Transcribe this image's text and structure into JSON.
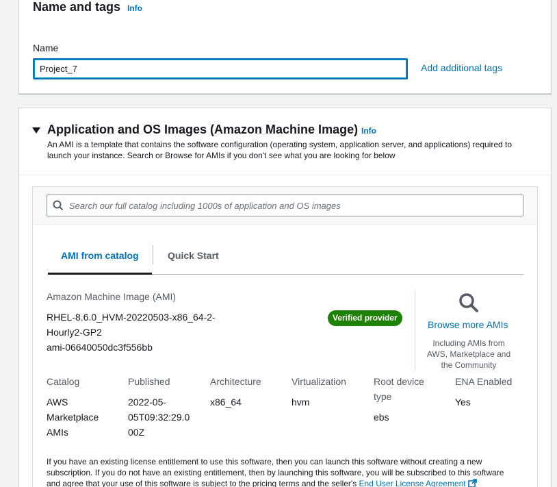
{
  "name_tags": {
    "title": "Name and tags",
    "info": "Info",
    "name_label": "Name",
    "name_value": "Project_7",
    "add_tags": "Add additional tags"
  },
  "ami_section": {
    "title": "Application and OS Images (Amazon Machine Image)",
    "info": "Info",
    "description_line1": "An AMI is a template that contains the software configuration (operating system, application server, and applications) required to",
    "description_line2": "launch your instance. Search or Browse for AMIs if you don't see what you are looking for below",
    "search_placeholder": "Search our full catalog including 1000s of application and OS images",
    "tabs": [
      {
        "label": "AMI from catalog",
        "active": true
      },
      {
        "label": "Quick Start",
        "active": false
      }
    ],
    "ami_label": "Amazon Machine Image (AMI)",
    "ami_name_line1": "RHEL-8.6.0_HVM-20220503-x86_64-2-",
    "ami_name_line2": "Hourly2-GP2",
    "ami_id": "ami-06640050dc3f556bb",
    "verified_badge": "Verified provider",
    "browse_more": "Browse more AMIs",
    "browse_desc_line1": "Including AMIs from",
    "browse_desc_line2": "AWS, Marketplace and",
    "browse_desc_line3": "the Community",
    "details": {
      "catalog": {
        "header": "Catalog",
        "value_lines": [
          "AWS",
          "Marketplace",
          "AMIs"
        ]
      },
      "published": {
        "header": "Published",
        "value_lines": [
          "2022-05-",
          "05T09:32:29.0",
          "00Z"
        ]
      },
      "architecture": {
        "header": "Architecture",
        "value": "x86_64"
      },
      "virtualization": {
        "header": "Virtualization",
        "value": "hvm"
      },
      "root_device": {
        "header_lines": [
          "Root device",
          "type"
        ],
        "value": "ebs"
      },
      "ena": {
        "header": "ENA Enabled",
        "value": "Yes"
      }
    },
    "license_line1": "If you have an existing license entitlement to use this software, then you can launch this software without creating a new",
    "license_line2": "subscription. If you do not have an existing entitlement, then by launching this software, you will be subscribed to this software",
    "license_line3": "and agree that your use of this software is subject to the pricing terms and the seller's",
    "eula_link": "End User License Agreement"
  },
  "colors": {
    "link": "#0073bb",
    "verified": "#1d8102",
    "focus_border": "#0073bb",
    "page_bg": "#f2f3f3"
  }
}
